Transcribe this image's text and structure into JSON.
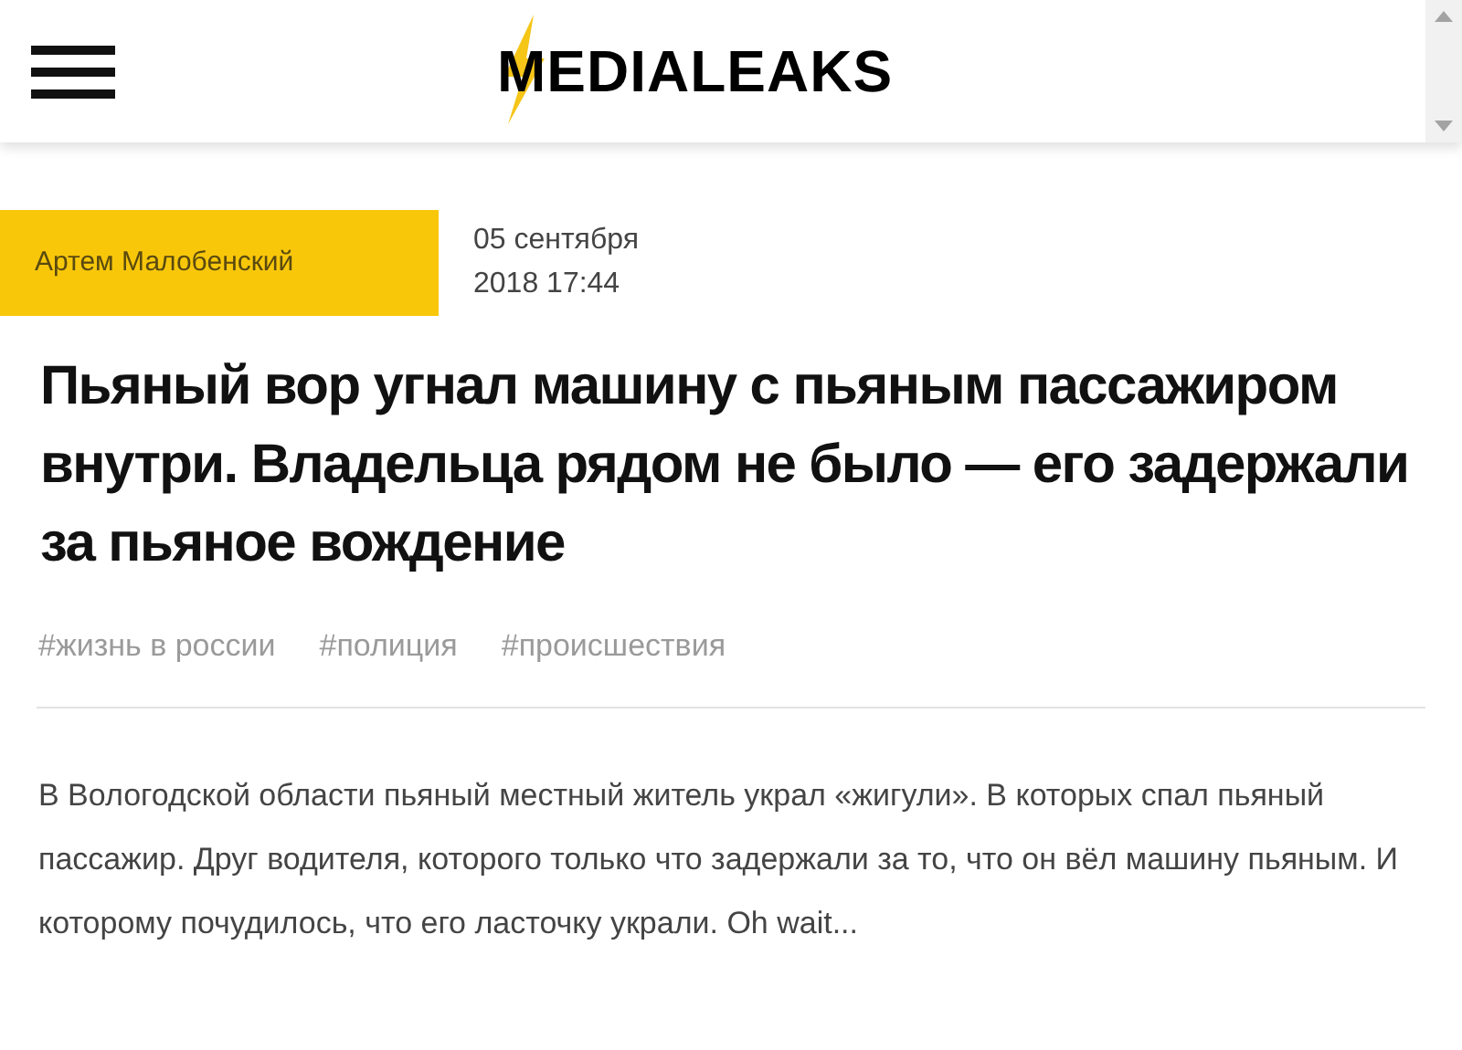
{
  "header": {
    "logo": "MEDIALEAKS"
  },
  "article": {
    "author": "Артем Малобенский",
    "date": "05 сентября",
    "time": "2018 17:44",
    "title": "Пьяный вор угнал машину с пьяным пассажиром внутри. Владельца рядом не было — его задержали за пьяное вождение",
    "tags": [
      "#жизнь в россии",
      "#полиция",
      "#происшествия"
    ],
    "lead": "В Вологодской области пьяный местный житель украл «жигули». В которых спал пьяный пассажир. Друг водителя, которого только что задержали за то, что он вёл машину пьяным. И которому почудилось, что его ласточку украли. Oh wait..."
  }
}
